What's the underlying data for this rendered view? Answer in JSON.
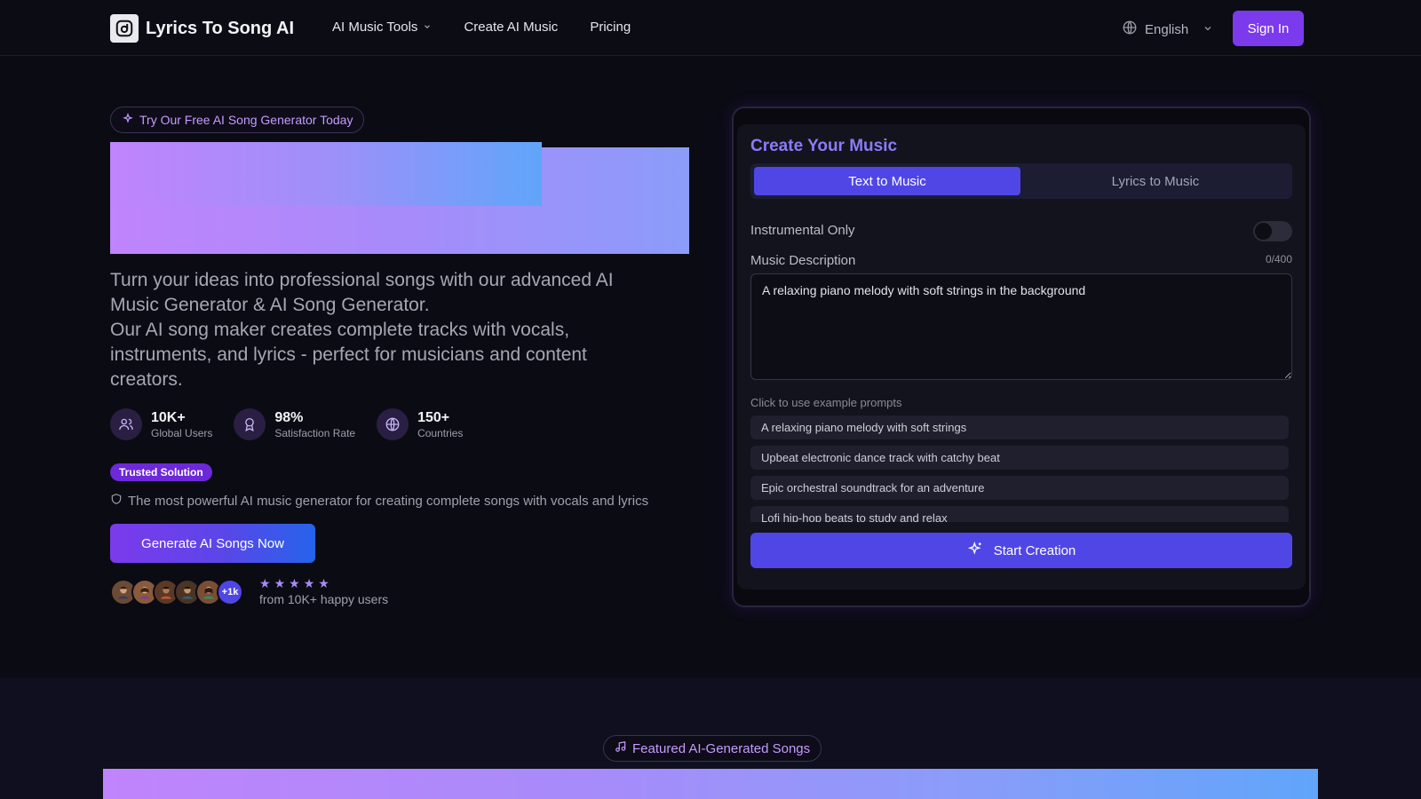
{
  "header": {
    "brand": "Lyrics To Song AI",
    "nav": [
      {
        "label": "AI Music Tools",
        "has_dropdown": true
      },
      {
        "label": "Create AI Music",
        "has_dropdown": false
      },
      {
        "label": "Pricing",
        "has_dropdown": false
      }
    ],
    "language": "English",
    "signin_label": "Sign In"
  },
  "hero": {
    "badge": "Try Our Free AI Song Generator Today",
    "description_line1": "Turn your ideas into professional songs with our advanced AI Music Generator & AI Song Generator.",
    "description_line2": "Our AI song maker creates complete tracks with vocals, instruments, and lyrics - perfect for musicians and content creators.",
    "stats": [
      {
        "value": "10K+",
        "label": "Global Users",
        "icon": "users-icon"
      },
      {
        "value": "98%",
        "label": "Satisfaction Rate",
        "icon": "award-icon"
      },
      {
        "value": "150+",
        "label": "Countries",
        "icon": "globe-icon"
      }
    ],
    "trusted_badge": "Trusted Solution",
    "powerful_text": "The most powerful AI music generator for creating complete songs with vocals and lyrics",
    "cta_label": "Generate AI Songs Now",
    "avatar_more": "+1k",
    "rating_stars": 5,
    "rating_text": "from 10K+ happy users"
  },
  "creator": {
    "title": "Create Your Music",
    "tabs": [
      {
        "label": "Text to Music",
        "active": true
      },
      {
        "label": "Lyrics to Music",
        "active": false
      }
    ],
    "instrumental_label": "Instrumental Only",
    "instrumental_on": false,
    "description_label": "Music Description",
    "counter": "0/400",
    "description_value": "A relaxing piano melody with soft strings in the background",
    "examples_label": "Click to use example prompts",
    "examples": [
      "A relaxing piano melody with soft strings",
      "Upbeat electronic dance track with catchy beat",
      "Epic orchestral soundtrack for an adventure",
      "Lofi hip-hop beats to study and relax"
    ],
    "start_label": "Start Creation"
  },
  "featured": {
    "badge": "Featured AI-Generated Songs"
  },
  "colors": {
    "accent": "#7c3aed",
    "primary": "#4f46e5",
    "background": "#0b0b14",
    "card": "#13131e"
  }
}
